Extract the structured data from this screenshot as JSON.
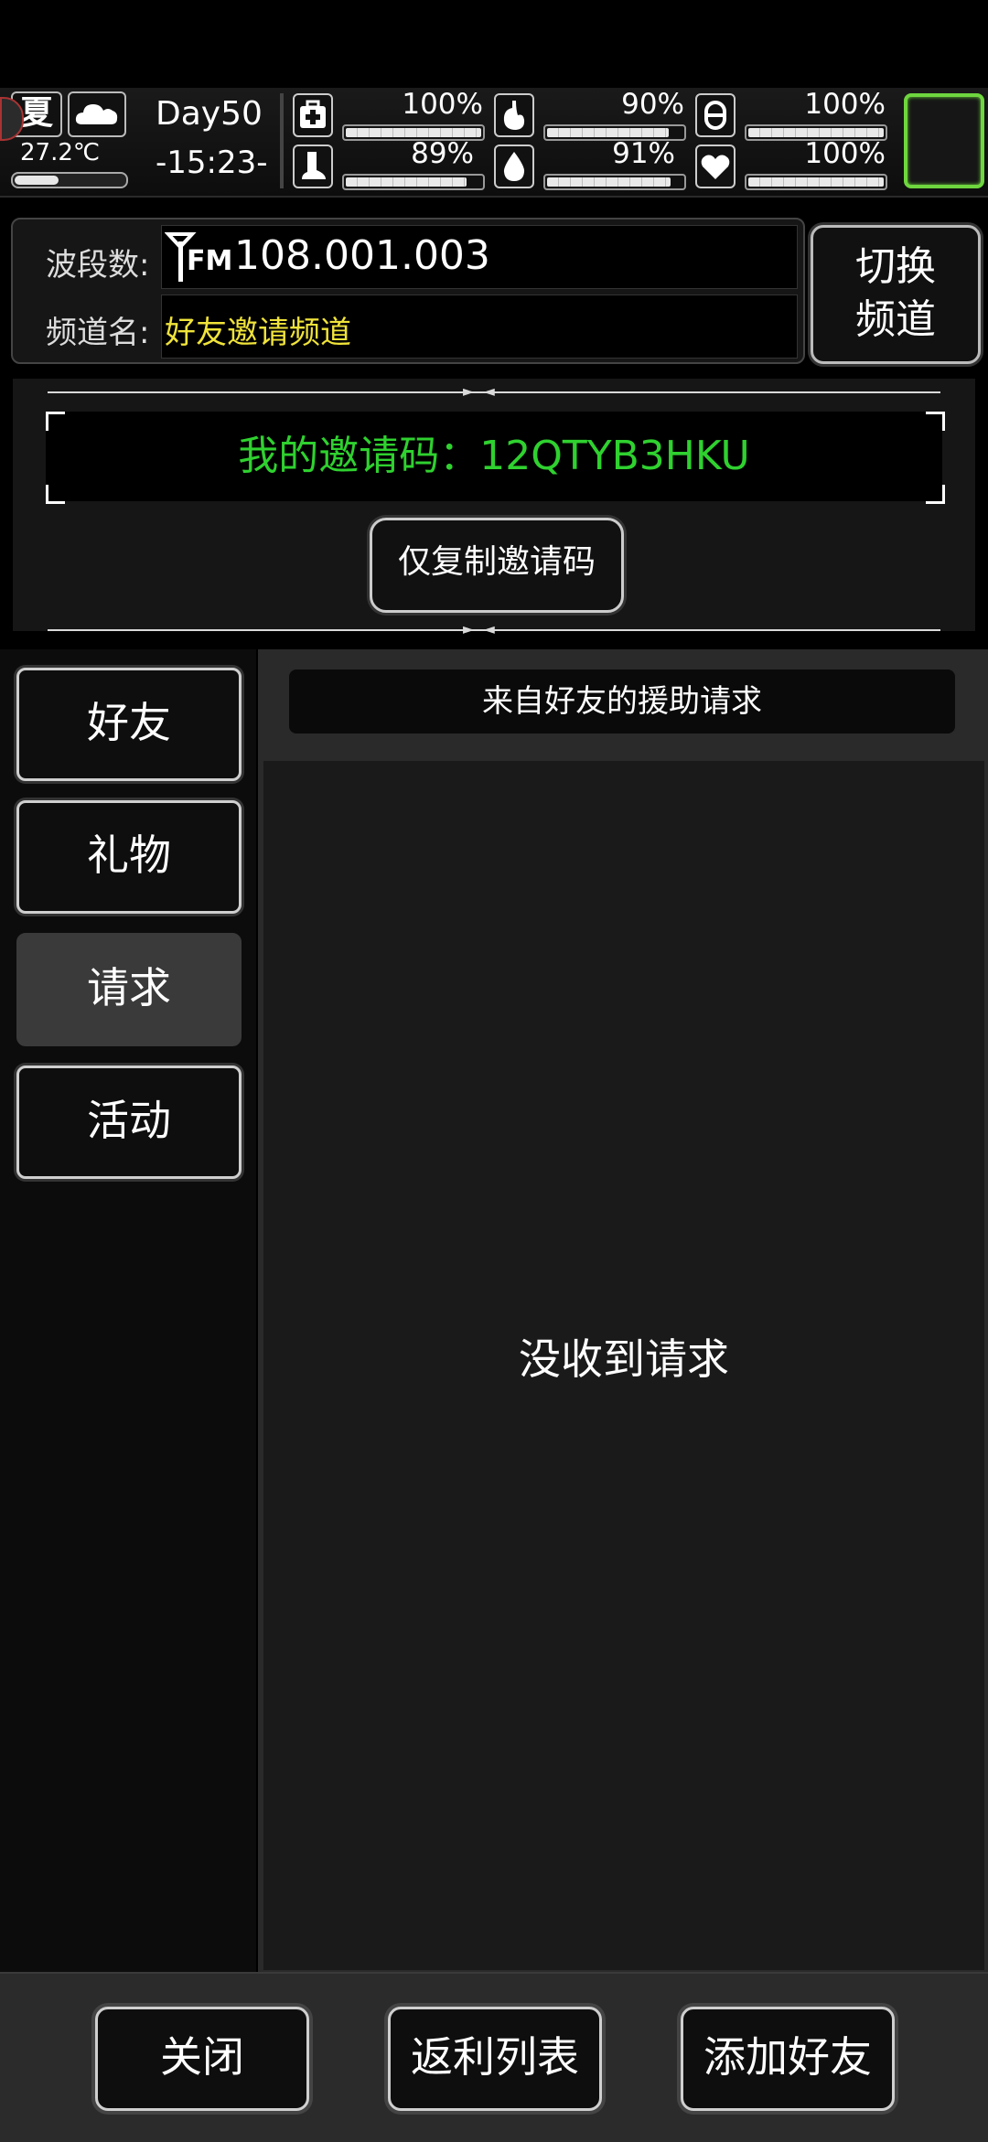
{
  "hud": {
    "season": "夏",
    "weather_icon": "cloud-icon",
    "temperature": "27.2℃",
    "thermometer_level": 0.4,
    "day": "Day50",
    "time": "-15:23-",
    "stats": [
      {
        "icon": "medkit-icon",
        "value": "100%",
        "level": 1.0
      },
      {
        "icon": "stomach-icon",
        "value": "90%",
        "level": 0.9
      },
      {
        "icon": "pill-icon",
        "value": "100%",
        "level": 1.0
      },
      {
        "icon": "foot-icon",
        "value": "89%",
        "level": 0.89
      },
      {
        "icon": "water-drop-icon",
        "value": "91%",
        "level": 0.91
      },
      {
        "icon": "heart-icon",
        "value": "100%",
        "level": 1.0
      }
    ]
  },
  "channel": {
    "band_label": "波段数:",
    "frequency": "108.001.003",
    "fm_label": "FM",
    "name_label": "频道名:",
    "name_value": "好友邀请频道",
    "switch_label_line1": "切换",
    "switch_label_line2": "频道"
  },
  "invite": {
    "code_text": "我的邀请码：12QTYB3HKU",
    "copy_button": "仅复制邀请码"
  },
  "tabs": [
    {
      "label": "好友",
      "active": false
    },
    {
      "label": "礼物",
      "active": false
    },
    {
      "label": "请求",
      "active": true
    },
    {
      "label": "活动",
      "active": false
    }
  ],
  "content": {
    "header": "来自好友的援助请求",
    "empty_message": "没收到请求"
  },
  "bottom": {
    "close": "关闭",
    "rebate_list": "返利列表",
    "add_friend": "添加好友"
  },
  "colors": {
    "accent_green": "#2fd12f",
    "channel_name_yellow": "#f0e33a",
    "avatar_border": "#6ed63e"
  }
}
